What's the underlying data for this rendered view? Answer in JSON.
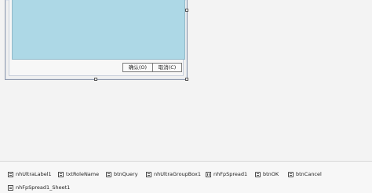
{
  "form": {
    "buttons": {
      "ok_label": "确认(O)",
      "cancel_label": "取消(C)"
    }
  },
  "component_tray": {
    "items": [
      {
        "label": "nhUltraLabel1",
        "icon": "label-icon"
      },
      {
        "label": "txtRoleName",
        "icon": "textbox-icon"
      },
      {
        "label": "btnQuery",
        "icon": "button-icon"
      },
      {
        "label": "nhUltraGroupBox1",
        "icon": "groupbox-icon"
      },
      {
        "label": "nhFpSpread1",
        "icon": "spread-icon"
      },
      {
        "label": "btnOK",
        "icon": "button-icon"
      },
      {
        "label": "btnCancel",
        "icon": "button-icon"
      },
      {
        "label": "nhFpSpread1_Sheet1",
        "icon": "sheet-icon"
      }
    ]
  },
  "colors": {
    "designer_background": "#f3f3f3",
    "grid_fill": "#add8e6",
    "form_border": "#8f99ac",
    "tray_background": "#f7f7f7"
  }
}
